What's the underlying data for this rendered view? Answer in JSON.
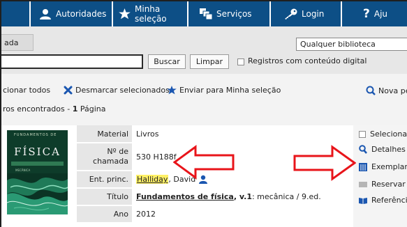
{
  "nav": {
    "items": [
      {
        "label": "",
        "icon": "home-icon"
      },
      {
        "label": "Autoridades",
        "icon": "users-icon"
      },
      {
        "label": "Minha seleção",
        "icon": "star-icon"
      },
      {
        "label": "Serviços",
        "icon": "services-icon"
      },
      {
        "label": "Login",
        "icon": "key-icon"
      },
      {
        "label": "Aju",
        "icon": "help-icon"
      }
    ],
    "help_glyph": "?"
  },
  "search": {
    "tab_label": "ada",
    "library_select": "Qualquer biblioteca",
    "query": "",
    "buscar_label": "Buscar",
    "limpar_label": "Limpar",
    "digital_label": "Registros com conteúdo digital"
  },
  "actions": {
    "select_all": "cionar todos",
    "deselect": "Desmarcar selecionados",
    "send_selection": "Enviar para Minha seleção",
    "new_search": "Nova pe"
  },
  "results": {
    "prefix": "ros encontrados - ",
    "pages_count": "1",
    "pages_label": " Página"
  },
  "record": {
    "cover": {
      "top_text": "FUNDAMENTOS DE",
      "title": "FÍSICA",
      "subtitle": "MECÂNICA"
    },
    "material_label": "Material",
    "material_value": "Livros",
    "callnumber_label_1": "Nº de",
    "callnumber_label_2": "chamada",
    "callnumber_value": "530 H188f",
    "entry_label": "Ent. princ.",
    "entry_highlight": "Halliday",
    "entry_rest": ", David",
    "title_label": "Título",
    "title_bold": "Fundamentos de física",
    "title_mid": ", v.1",
    "title_rest": " : mecânica / 9.ed.",
    "year_label": "Ano",
    "year_value": "2012"
  },
  "sidebar": {
    "select": "Selecionar",
    "details": "Detalhes",
    "copies": "Exemplares",
    "reserve": "Reservar",
    "references": "Referência"
  },
  "colors": {
    "nav_bg": "#0d4f86",
    "arrow_red": "#e8141a",
    "highlight": "#fff066",
    "link_blue": "#1a56b0"
  }
}
